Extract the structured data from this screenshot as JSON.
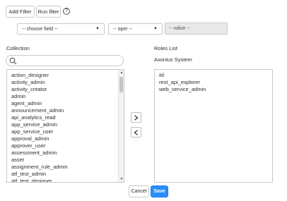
{
  "toolbar": {
    "add_filter_label": "Add Filter",
    "run_filter_label": "Run filter",
    "help_symbol": "?"
  },
  "filter": {
    "field_selected": "-- choose field --",
    "operator_selected": "-- oper --",
    "value_placeholder": "-- value --"
  },
  "collection": {
    "heading": "Collection",
    "search_value": "",
    "items": [
      "action_designer",
      "activity_admin",
      "activity_creator",
      "admin",
      "agent_admin",
      "announcement_admin",
      "api_analytics_read",
      "app_service_admin",
      "app_service_user",
      "approval_admin",
      "approver_user",
      "assessment_admin",
      "asset",
      "assignment_rule_admin",
      "atf_test_admin",
      "atf_test_designer"
    ]
  },
  "roles": {
    "heading": "Roles List",
    "subheading": "Axonius System",
    "items": [
      "itil",
      "rest_api_explorer",
      "web_service_admin"
    ]
  },
  "actions": {
    "cancel_label": "Cancel",
    "save_label": "Save"
  },
  "colors": {
    "accent": "#278efc",
    "border": "#c9c9c9"
  }
}
